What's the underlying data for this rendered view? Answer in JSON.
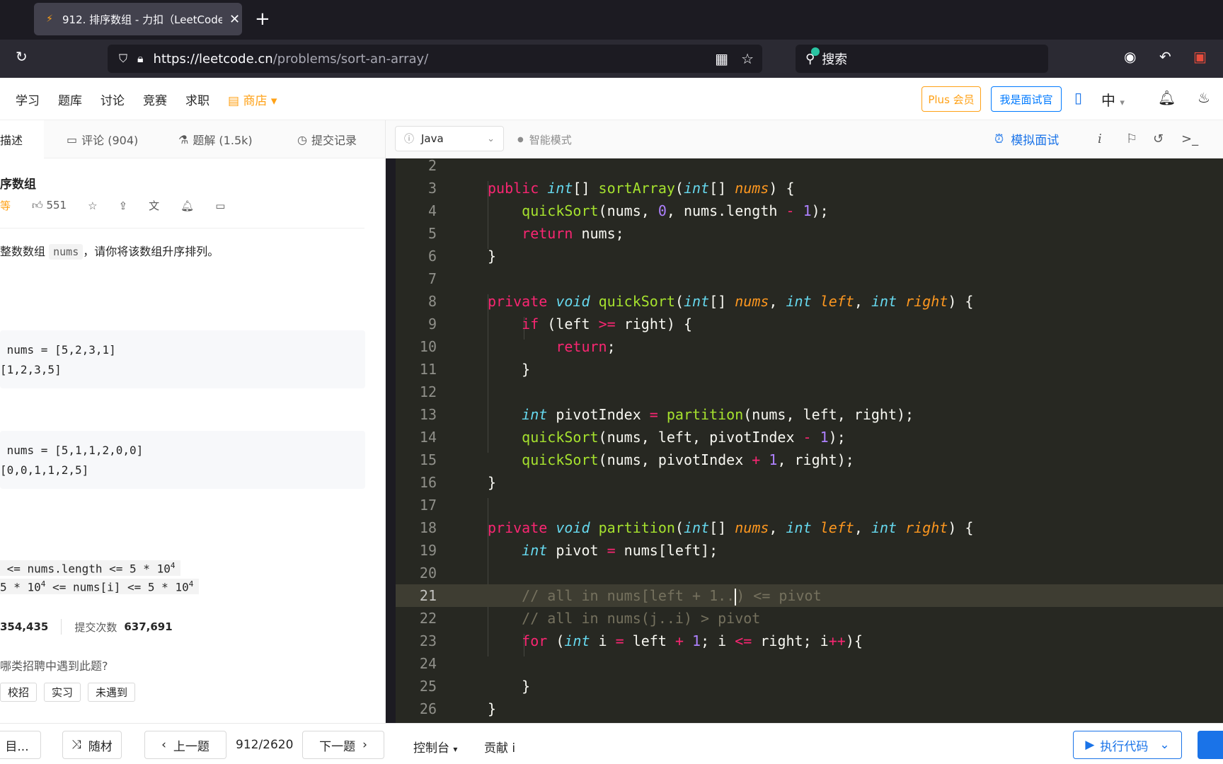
{
  "browser": {
    "tab_title": "912. 排序数组 - 力扣（LeetCode）",
    "url_domain": "https://leetcode.cn",
    "url_path": "/problems/sort-an-array/",
    "search_placeholder": "搜索"
  },
  "site_nav": {
    "items": [
      "学习",
      "题库",
      "讨论",
      "竞赛",
      "求职"
    ],
    "store": "商店",
    "plus_label": "Plus 会员",
    "interviewer_label": "我是面试官",
    "lang": "中"
  },
  "left_tabs": {
    "desc": "描述",
    "comments": "评论 (904)",
    "solutions": "题解 (1.5k)",
    "submissions": "提交记录"
  },
  "problem": {
    "title": "序数组",
    "difficulty": "等",
    "likes": "551",
    "desc_prefix": "整数数组",
    "desc_code": "nums",
    "desc_suffix": "，请你将该数组升序排列。",
    "ex1_input": "nums = [5,2,3,1]",
    "ex1_output": "[1,2,3,5]",
    "ex2_input": "nums = [5,1,1,2,0,0]",
    "ex2_output": "[0,0,1,1,2,5]",
    "c1_text": "<= nums.length <= 5 * 10",
    "c1_exp": "4",
    "c2_a": "5 * 10",
    "c2_exp1": "4",
    "c2_b": " <= nums[i] <= 5 * 10",
    "c2_exp2": "4",
    "accepted_value": "354,435",
    "submissions_label": "提交次数",
    "submissions_value": "637,691",
    "ask": "哪类招聘中遇到此题?",
    "pills": [
      "校招",
      "实习",
      "未遇到"
    ]
  },
  "editor_toolbar": {
    "language": "Java",
    "smart_mode": "智能模式",
    "mock_interview": "模拟面试"
  },
  "bottom": {
    "list_label": "目...",
    "random_label": "随材",
    "prev_label": "上一题",
    "counter": "912/2620",
    "next_label": "下一题",
    "console_label": "控制台",
    "contribute_label": "贡献 i",
    "run_label": "执行代码"
  },
  "code_lines": [
    "2",
    "3",
    "4",
    "5",
    "6",
    "7",
    "8",
    "9",
    "10",
    "11",
    "12",
    "13",
    "14",
    "15",
    "16",
    "17",
    "18",
    "19",
    "20",
    "21",
    "22",
    "23",
    "24",
    "25",
    "26"
  ],
  "colors": {
    "accent": "#1a73e8",
    "brand_orange": "#ffa116",
    "editor_bg": "#272822"
  }
}
